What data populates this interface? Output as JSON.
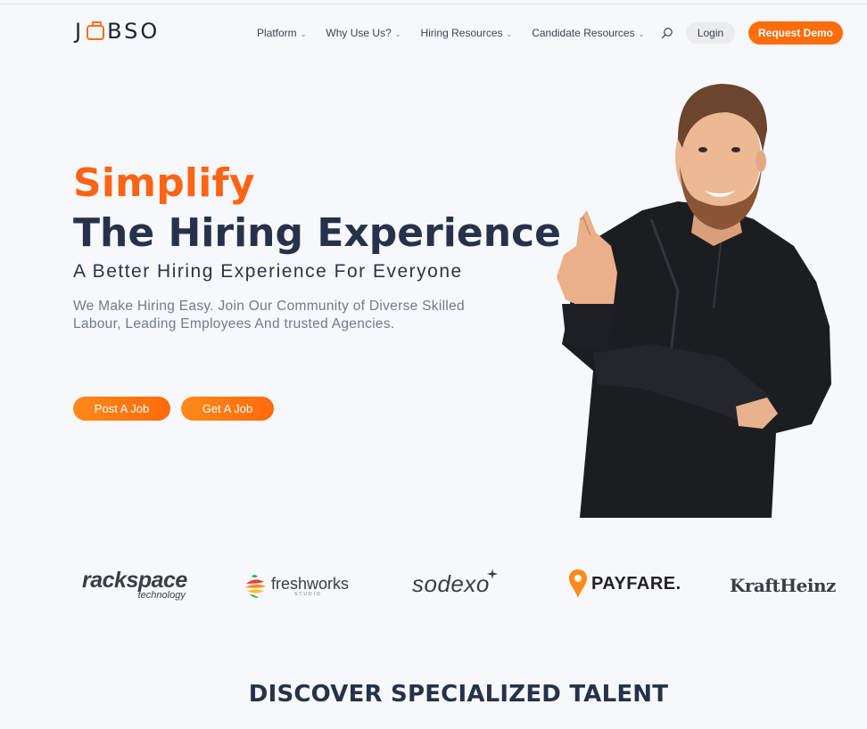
{
  "header": {
    "logo_text": "JOBSO",
    "nav": [
      {
        "label": "Platform"
      },
      {
        "label": "Why Use Us?"
      },
      {
        "label": "Hiring Resources"
      },
      {
        "label": "Candidate Resources"
      }
    ],
    "search_icon": "search-icon",
    "login_label": "Login",
    "demo_label": "Request Demo"
  },
  "hero": {
    "title_line1": "Simplify",
    "title_line2": "The Hiring Experience",
    "subtitle": "A Better Hiring Experience For Everyone",
    "description": "We Make Hiring Easy. Join Our Community of Diverse Skilled Labour, Leading Employees And trusted Agencies.",
    "post_job_label": "Post A Job",
    "get_job_label": "Get A Job"
  },
  "brands": {
    "rackspace": "rackspace",
    "rackspace_sub": "technology",
    "freshworks": "freshworks",
    "freshworks_sub": "STUDIO",
    "sodexo": "sodexo",
    "payfare": "PAYFARE.",
    "kraftheinz": "KraftHeinz"
  },
  "section": {
    "discover_title": "DISCOVER SPECIALIZED TALENT"
  },
  "colors": {
    "accent": "#ff6d0c",
    "heading": "#27324a",
    "background": "#f7f8fc"
  }
}
